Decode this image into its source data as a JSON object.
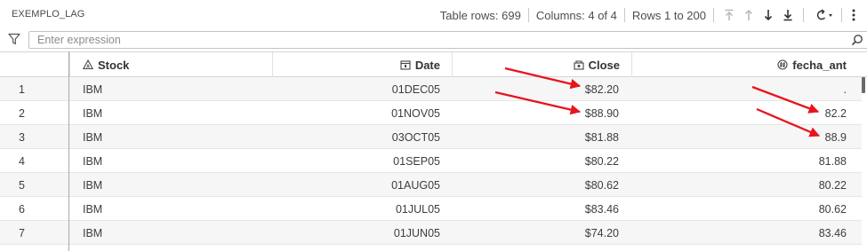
{
  "toolbar": {
    "title": "EXEMPLO_LAG",
    "table_rows": "Table rows: 699",
    "columns": "Columns: 4 of 4",
    "rows_range": "Rows 1 to 200"
  },
  "icons": {
    "first": "arrow-to-top-icon",
    "previous": "arrow-up-icon",
    "next": "arrow-down-icon",
    "last": "arrow-to-bottom-icon",
    "refresh": "refresh-icon",
    "more": "more-vertical-icon",
    "filter": "filter-icon",
    "search": "search-icon"
  },
  "filter": {
    "placeholder": "Enter expression",
    "value": ""
  },
  "table": {
    "headers": [
      "Stock",
      "Date",
      "Close",
      "fecha_ant"
    ],
    "header_icons": [
      "character-type-icon",
      "date-type-icon",
      "currency-type-icon",
      "numeric-type-icon"
    ],
    "rows": [
      {
        "n": "1",
        "stock": "IBM",
        "date": "01DEC05",
        "close": "$82.20",
        "fecha_ant": "."
      },
      {
        "n": "2",
        "stock": "IBM",
        "date": "01NOV05",
        "close": "$88.90",
        "fecha_ant": "82.2"
      },
      {
        "n": "3",
        "stock": "IBM",
        "date": "03OCT05",
        "close": "$81.88",
        "fecha_ant": "88.9"
      },
      {
        "n": "4",
        "stock": "IBM",
        "date": "01SEP05",
        "close": "$80.22",
        "fecha_ant": "81.88"
      },
      {
        "n": "5",
        "stock": "IBM",
        "date": "01AUG05",
        "close": "$80.62",
        "fecha_ant": "80.22"
      },
      {
        "n": "6",
        "stock": "IBM",
        "date": "01JUL05",
        "close": "$83.46",
        "fecha_ant": "80.62"
      },
      {
        "n": "7",
        "stock": "IBM",
        "date": "01JUN05",
        "close": "$74.20",
        "fecha_ant": "83.46"
      }
    ]
  },
  "colors": {
    "arrow": "#e8141c",
    "row_alt": "#f6f6f6",
    "separator": "#a9a9a9"
  }
}
